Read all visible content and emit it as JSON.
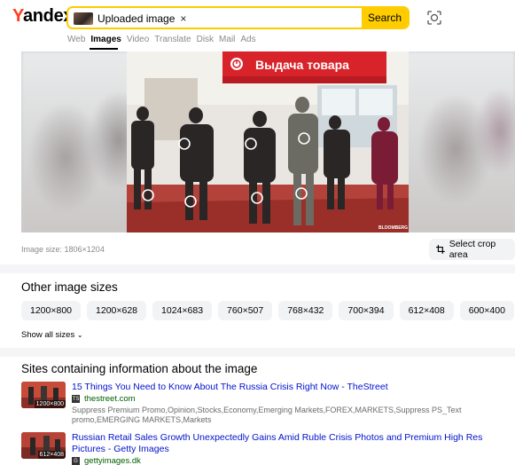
{
  "header": {
    "logo": "Yandex",
    "search_chip_label": "Uploaded image",
    "search_chip_close": "×",
    "search_button": "Search",
    "camera_icon": "camera-lens-icon",
    "tabs": [
      {
        "label": "Web",
        "active": false
      },
      {
        "label": "Images",
        "active": true
      },
      {
        "label": "Video",
        "active": false
      },
      {
        "label": "Translate",
        "active": false
      },
      {
        "label": "Disk",
        "active": false
      },
      {
        "label": "Mail",
        "active": false
      },
      {
        "label": "Ads",
        "active": false
      }
    ]
  },
  "preview": {
    "sign_text": "Выдача товара",
    "watermark": "BLOOMBERG",
    "image_size_label": "Image size: 1806×1204",
    "crop_button": "Select crop area"
  },
  "other_sizes": {
    "heading": "Other image sizes",
    "sizes": [
      "1200×800",
      "1200×628",
      "1024×683",
      "760×507",
      "768×432",
      "700×394",
      "612×408",
      "600×400"
    ],
    "show_all": "Show all sizes"
  },
  "sites": {
    "heading": "Sites containing information about the image",
    "results": [
      {
        "title": "15 Things You Need to Know About The Russia Crisis Right Now - TheStreet",
        "domain": "thestreet.com",
        "favicon": "TS",
        "thumb_size": "1200×800",
        "description": "Suppress Premium Promo,Opinion,Stocks,Economy,Emerging Markets,FOREX,MARKETS,Suppress PS_Text promo,EMERGING MARKETS,Markets"
      },
      {
        "title": "Russian Retail Sales Growth Unexpectedly Gains Amid Ruble Crisis Photos and Premium High Res Pictures - Getty Images",
        "domain": "gettyimages.dk",
        "favicon": "G",
        "thumb_size": "612×408",
        "description": ""
      }
    ]
  },
  "colors": {
    "brand_red": "#fc3f1d",
    "accent_yellow": "#ffcc00",
    "link_blue": "#0012cc",
    "domain_green": "#006000"
  }
}
